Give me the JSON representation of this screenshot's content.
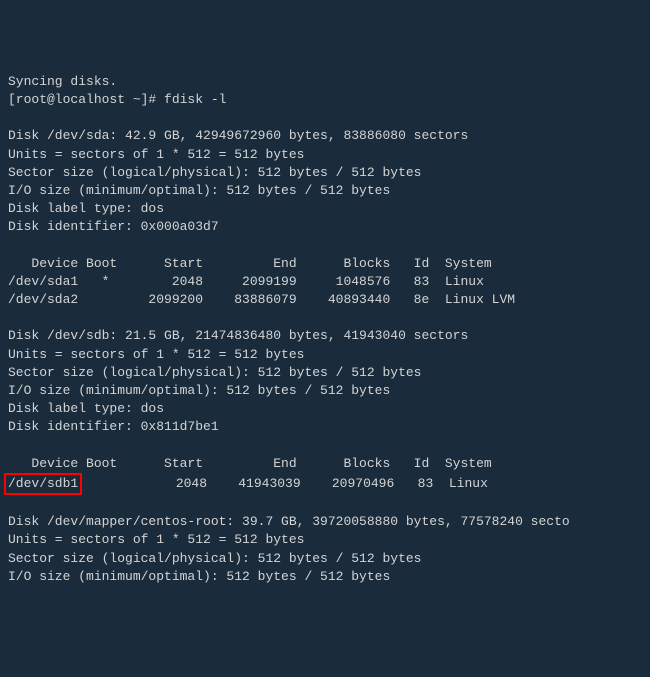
{
  "lines": {
    "line0": "Syncing disks.",
    "prompt": "[root@localhost ~]# fdisk -l",
    "blank": "",
    "disk_sda_header": "Disk /dev/sda: 42.9 GB, 42949672960 bytes, 83886080 sectors",
    "disk_sda_units": "Units = sectors of 1 * 512 = 512 bytes",
    "disk_sda_sector": "Sector size (logical/physical): 512 bytes / 512 bytes",
    "disk_sda_io": "I/O size (minimum/optimal): 512 bytes / 512 bytes",
    "disk_sda_label": "Disk label type: dos",
    "disk_sda_id": "Disk identifier: 0x000a03d7",
    "sda_table_header": "   Device Boot      Start         End      Blocks   Id  System",
    "sda_row1": "/dev/sda1   *        2048     2099199     1048576   83  Linux",
    "sda_row2": "/dev/sda2         2099200    83886079    40893440   8e  Linux LVM",
    "disk_sdb_header": "Disk /dev/sdb: 21.5 GB, 21474836480 bytes, 41943040 sectors",
    "disk_sdb_units": "Units = sectors of 1 * 512 = 512 bytes",
    "disk_sdb_sector": "Sector size (logical/physical): 512 bytes / 512 bytes",
    "disk_sdb_io": "I/O size (minimum/optimal): 512 bytes / 512 bytes",
    "disk_sdb_label": "Disk label type: dos",
    "disk_sdb_id": "Disk identifier: 0x811d7be1",
    "sdb_table_header": "   Device Boot      Start         End      Blocks   Id  System",
    "sdb_row1_device": "/dev/sdb1",
    "sdb_row1_rest": "            2048    41943039    20970496   83  Linux",
    "disk_mapper_header": "Disk /dev/mapper/centos-root: 39.7 GB, 39720058880 bytes, 77578240 secto",
    "disk_mapper_units": "Units = sectors of 1 * 512 = 512 bytes",
    "disk_mapper_sector": "Sector size (logical/physical): 512 bytes / 512 bytes",
    "disk_mapper_io": "I/O size (minimum/optimal): 512 bytes / 512 bytes"
  }
}
